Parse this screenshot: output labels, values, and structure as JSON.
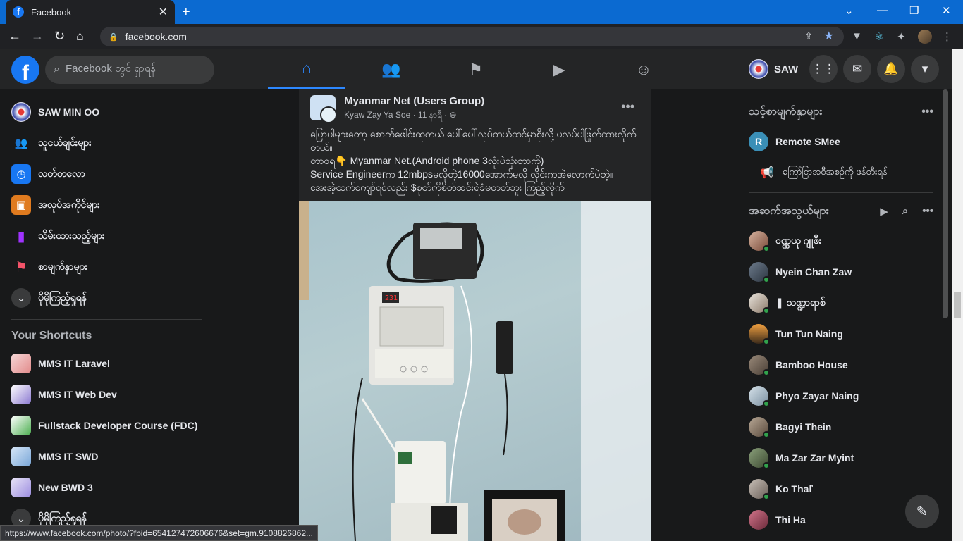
{
  "browser": {
    "tab_title": "Facebook",
    "url": "facebook.com",
    "status_url": "https://www.facebook.com/photo/?fbid=654127472606676&set=gm.9108826862..."
  },
  "header": {
    "search_placeholder": "Facebook တွင် ရှာရန်",
    "profile_name": "SAW"
  },
  "left": {
    "items": [
      {
        "label": "SAW MIN OO",
        "icon": "profile-avatar"
      },
      {
        "label": "သူငယ်ချင်းများ",
        "icon": "friends-icon"
      },
      {
        "label": "လတ်တလော",
        "icon": "clock-icon"
      },
      {
        "label": "အလုပ်အကိုင်များ",
        "icon": "briefcase-icon"
      },
      {
        "label": "သိမ်းထားသည့်များ",
        "icon": "bookmark-icon"
      },
      {
        "label": "စာမျက်နှာများ",
        "icon": "flag-icon"
      },
      {
        "label": "ပိုမိုကြည့်ရှုရန်",
        "icon": "chevron-down-icon"
      }
    ],
    "shortcuts_title": "Your Shortcuts",
    "shortcuts": [
      {
        "label": "MMS IT Laravel"
      },
      {
        "label": "MMS IT Web Dev"
      },
      {
        "label": "Fullstack Developer Course (FDC)"
      },
      {
        "label": "MMS IT SWD"
      },
      {
        "label": "New BWD 3"
      },
      {
        "label": "ပိုမိုကြည့်ရှုရန်"
      }
    ]
  },
  "post": {
    "group_name": "Myanmar Net (Users Group)",
    "author_line": "Kyaw Zay Ya Soe · 11 နာရီ · ",
    "lines": [
      "ပြောပါများတော့ စောက်ဖေါင်းထုတယ် ပေါ်ပေါ်လုပ်တယ်ထင်မှာစိုးလို့ ပလပ်ပါဖြုတ်ထားလိုက်တယ်။",
      "တာဝရ👇 Myanmar Net.(Android phone 3လုံးပဲသုံးတာကို)",
      "Service Engineerက 12mbpsမလိုတဲ့16000အောက်မလို လိုင်းကအဲလောက်ပဲတဲ့။",
      "အေးအဲ့ထက်ကျော်ရင်လည်း $စုတ်ကိုစိတ်ဆင်းရဲခံမတတ်ဘူး ကြည့်လိုက်"
    ],
    "led_reading": "231"
  },
  "right": {
    "pages_title": "သင့်စာမျက်နှာများ",
    "page_name": "Remote SMee",
    "page_initial": "R",
    "promote_label": "ကြော်ငြာအစီအစဉ်ကို ဖန်တီးရန်",
    "contacts_title": "အဆက်အသွယ်များ",
    "contacts": [
      {
        "name": "ဝဏ္ဏယု ဂျူဖီး"
      },
      {
        "name": "Nyein Chan Zaw"
      },
      {
        "name": "❚ သဏ္ဍာရာစ်"
      },
      {
        "name": "Tun Tun Naing"
      },
      {
        "name": "Bamboo House"
      },
      {
        "name": "Phyo Zayar Naing"
      },
      {
        "name": "Bagyi Thein"
      },
      {
        "name": "Ma Zar Zar Myint"
      },
      {
        "name": "Ko Thaľ"
      },
      {
        "name": "Thi Ha"
      }
    ]
  },
  "colors": {
    "accent": "#2d88ff",
    "brand": "#1877f2",
    "online": "#31a24c"
  }
}
